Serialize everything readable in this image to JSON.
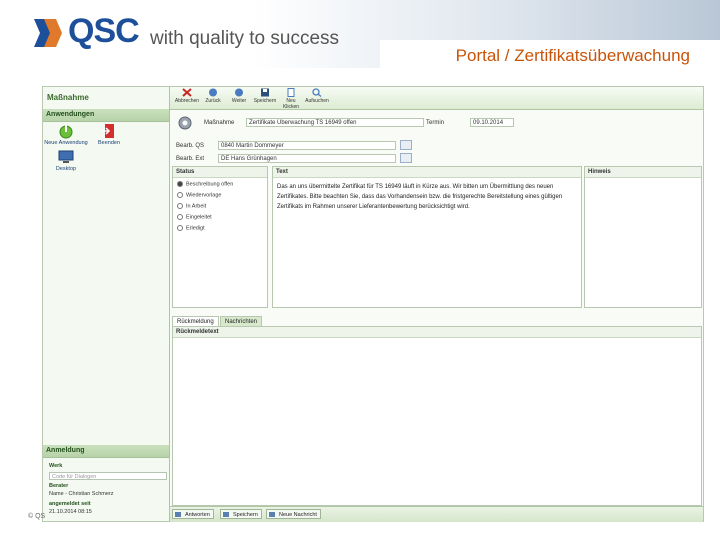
{
  "slide": {
    "logo_text": "QSC",
    "tagline": "with quality to success",
    "title": "Portal / Zertifikatsüberwachung",
    "copyright": "© QS"
  },
  "app": {
    "header": "Maßnahme",
    "left_section_title": "Anwendungen",
    "launchers": [
      {
        "label": "Neue Anwendung",
        "icon": "power-icon"
      },
      {
        "label": "Beenden",
        "icon": "exit-icon"
      },
      {
        "label": "Desktop",
        "icon": "desktop-icon"
      }
    ],
    "anmeldung_title": "Anmeldung",
    "werk_label": "Werk",
    "werk_placeholder": "Code für Dialogen",
    "berater_label": "Berater",
    "berater_value": "Name - Christian Schmerz",
    "angemeldet_label": "angemeldet seit",
    "angemeldet_value": "21.10.2014 08:15"
  },
  "toolbar": {
    "items": [
      {
        "label": "Abbrechen",
        "icon": "close-icon"
      },
      {
        "label": "Zurück",
        "icon": "back-icon"
      },
      {
        "label": "Weiter",
        "icon": "forward-icon"
      },
      {
        "label": "Speichern",
        "icon": "save-icon"
      },
      {
        "label": "Neu Klicken",
        "icon": "new-icon"
      },
      {
        "label": "Aufsuchen",
        "icon": "search-icon"
      }
    ]
  },
  "form": {
    "massnahme_label": "Maßnahme",
    "massnahme_value": "Zertifikate Überwachung TS 16949 offen",
    "termin_label": "Termin",
    "termin_value": "09.10.2014",
    "bearb_qs_label": "Bearb. QS",
    "bearb_qs_value": "0840 Martin Dommeyer",
    "bearb_ext_label": "Bearb. Ext",
    "bearb_ext_value": "DE Hans Grünhagen",
    "status_title": "Status",
    "status_options": [
      "Beschreibung offen",
      "Wiedervorlage",
      "In Arbeit",
      "Eingeleitet",
      "Erledigt"
    ],
    "text_title": "Text",
    "text_body": "Das an uns übermittelte Zertifikat für TS 16949 läuft in Kürze aus. Wir bitten um Übermittlung des neuen Zertifikates. Bitte beachten Sie, dass das Vorhandensein bzw. die fristgerechte Bereitstellung eines gültigen Zertifikats im Rahmen unserer Lieferantenbewertung berücksichtigt wird.",
    "hinweis_title": "Hinweis",
    "tabs": [
      "Rückmeldung",
      "Nachrichten"
    ],
    "reply_title": "Rückmeldetext",
    "bottom_buttons": [
      "Antworten",
      "Speichern",
      "Neue Nachricht"
    ]
  },
  "colors": {
    "brand_blue": "#1d4f9a",
    "title_orange": "#c8540a",
    "app_green": "#d9ead0"
  }
}
